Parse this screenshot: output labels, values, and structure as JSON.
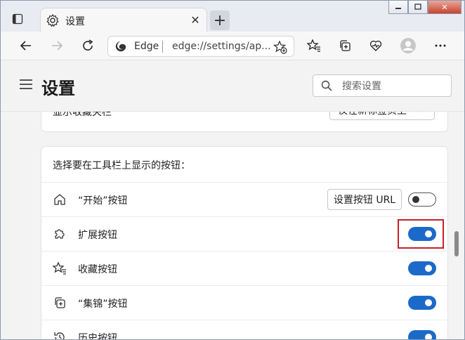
{
  "tab": {
    "title": "设置",
    "close_glyph": "✕"
  },
  "new_tab_glyph": "+",
  "window_controls": {
    "minimize": "▭",
    "maximize": "□",
    "close": "✕"
  },
  "address_bar": {
    "brand": "Edge",
    "url": "edge://settings/ap..."
  },
  "header": {
    "title": "设置",
    "search_placeholder": "搜索设置"
  },
  "favorites_bar": {
    "label": "显示收藏夹栏",
    "selected": "仅在新标签页上"
  },
  "toolbar_section": {
    "title": "选择要在工具栏上显示的按钮：",
    "rows": [
      {
        "label": "“开始”按钮",
        "icon": "home-icon",
        "enabled": false,
        "extra_button": "设置按钮 URL"
      },
      {
        "label": "扩展按钮",
        "icon": "puzzle-icon",
        "enabled": true
      },
      {
        "label": "收藏按钮",
        "icon": "favorites-icon",
        "enabled": true
      },
      {
        "label": "“集锦”按钮",
        "icon": "collections-icon",
        "enabled": true
      },
      {
        "label": "历史按钮",
        "icon": "history-icon",
        "enabled": true
      }
    ]
  },
  "colors": {
    "accent": "#1b6ac9",
    "highlight": "#c7202a"
  }
}
